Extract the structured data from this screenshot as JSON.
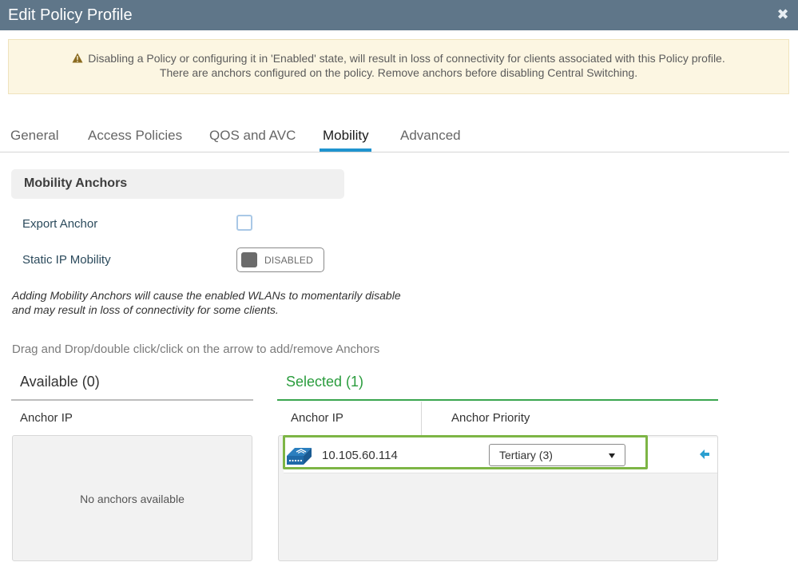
{
  "header": {
    "title": "Edit Policy Profile",
    "close_icon": "close-icon"
  },
  "alert": {
    "icon": "warning-icon",
    "line1": "Disabling a Policy or configuring it in 'Enabled' state, will result in loss of connectivity for clients associated with this Policy profile.",
    "line2": "There are anchors configured on the policy. Remove anchors before disabling Central Switching."
  },
  "tabs": [
    {
      "label": "General",
      "active": false
    },
    {
      "label": "Access Policies",
      "active": false
    },
    {
      "label": "QOS and AVC",
      "active": false
    },
    {
      "label": "Mobility",
      "active": true
    },
    {
      "label": "Advanced",
      "active": false
    }
  ],
  "mobility": {
    "section_title": "Mobility Anchors",
    "export_anchor_label": "Export Anchor",
    "export_anchor_checked": false,
    "static_ip_label": "Static IP Mobility",
    "static_ip_state": "DISABLED",
    "note_line1": "Adding Mobility Anchors will cause the enabled WLANs to momentarily disable",
    "note_line2": "and may result in loss of connectivity for some clients.",
    "drag_hint": "Drag and Drop/double click/click on the arrow to add/remove Anchors"
  },
  "available": {
    "title": "Available (0)",
    "column": "Anchor IP",
    "empty_text": "No anchors available"
  },
  "selected": {
    "title": "Selected (1)",
    "columns": [
      "Anchor IP",
      "Anchor Priority"
    ],
    "rows": [
      {
        "ip": "10.105.60.114",
        "priority": "Tertiary (3)",
        "icon": "wireless-controller-icon",
        "action_icon": "arrow-left-icon"
      }
    ]
  },
  "colors": {
    "titlebar": "#5f7689",
    "alert_bg": "#fcf6e2",
    "tab_accent": "#1f94cf",
    "selected_green": "#2a9c3d",
    "highlight_green": "#7db545",
    "arrow_blue": "#2b9fd0"
  }
}
